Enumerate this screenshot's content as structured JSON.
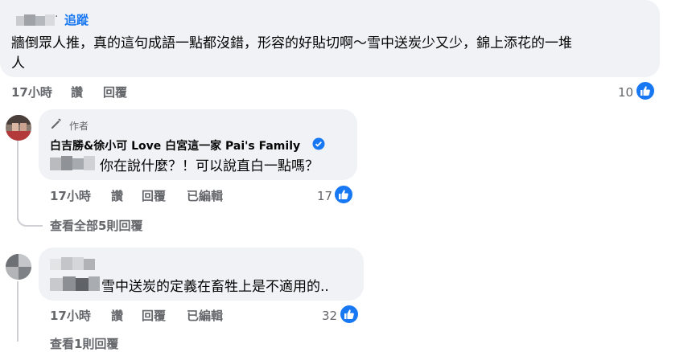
{
  "comment1": {
    "follow_label": "追蹤",
    "text_line1": "牆倒眾人推，真的這句成語一點都沒錯，形容的好貼切啊～雪中送炭少又少，錦上添花的一堆",
    "text_line2": "人",
    "time": "17小時",
    "like_action": "讚",
    "reply_action": "回覆",
    "reaction_count": "10"
  },
  "reply1": {
    "author_badge": "作者",
    "author_name": "白吉勝&徐小可 Love 白宮這一家 Pai's Family",
    "text": "你在說什麼？！可以說直白一點嗎？",
    "time": "17小時",
    "like_action": "讚",
    "reply_action": "回覆",
    "edited_label": "已編輯",
    "reaction_count": "17"
  },
  "view_all_replies": "查看全部5則回覆",
  "reply2": {
    "text": "雪中送炭的定義在畜牲上是不適用的..",
    "time": "17小時",
    "like_action": "讚",
    "reply_action": "回覆",
    "edited_label": "已編輯",
    "reaction_count": "32"
  },
  "view_more_partial": "查看1則回覆",
  "colors": {
    "accent": "#1877f2",
    "bubble": "#f0f2f5",
    "secondary_text": "#65676b"
  },
  "icons": [
    "pencil-icon",
    "verified-badge-icon",
    "thumbs-up-icon"
  ]
}
